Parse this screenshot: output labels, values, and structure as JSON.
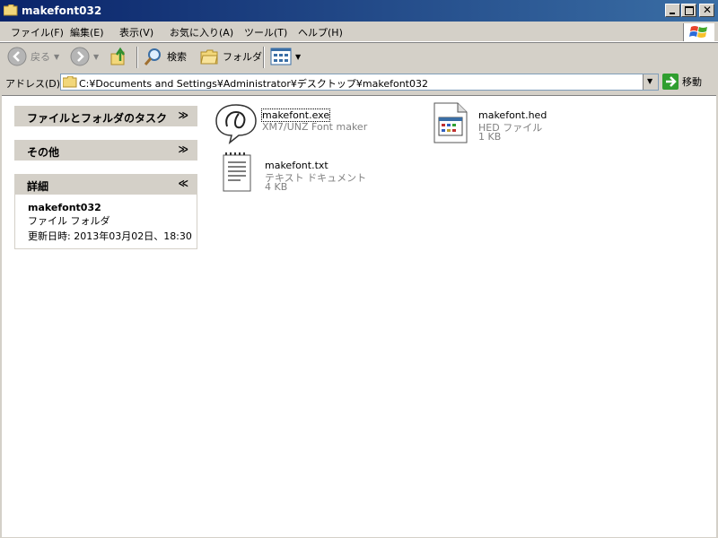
{
  "window": {
    "title": "makefont032"
  },
  "menu": [
    "ファイル(F)",
    "編集(E)",
    "表示(V)",
    "お気に入り(A)",
    "ツール(T)",
    "ヘルプ(H)"
  ],
  "toolbar": {
    "back_label": "戻る",
    "search_label": "検索",
    "folders_label": "フォルダ"
  },
  "address": {
    "label": "アドレス(D)",
    "path": "C:¥Documents and Settings¥Administrator¥デスクトップ¥makefont032",
    "go_label": "移動"
  },
  "sidebar": {
    "tasks_title": "ファイルとフォルダのタスク",
    "other_title": "その他",
    "details_title": "詳細",
    "details": {
      "name": "makefont032",
      "type": "ファイル フォルダ",
      "modified": "更新日時: 2013年03月02日、18:30"
    }
  },
  "files": [
    {
      "name": "makefont.exe",
      "type": "XM7/UNZ Font maker",
      "size": ""
    },
    {
      "name": "makefont.hed",
      "type": "HED ファイル",
      "size": "1 KB"
    },
    {
      "name": "makefont.txt",
      "type": "テキスト ドキュメント",
      "size": "4 KB"
    }
  ]
}
